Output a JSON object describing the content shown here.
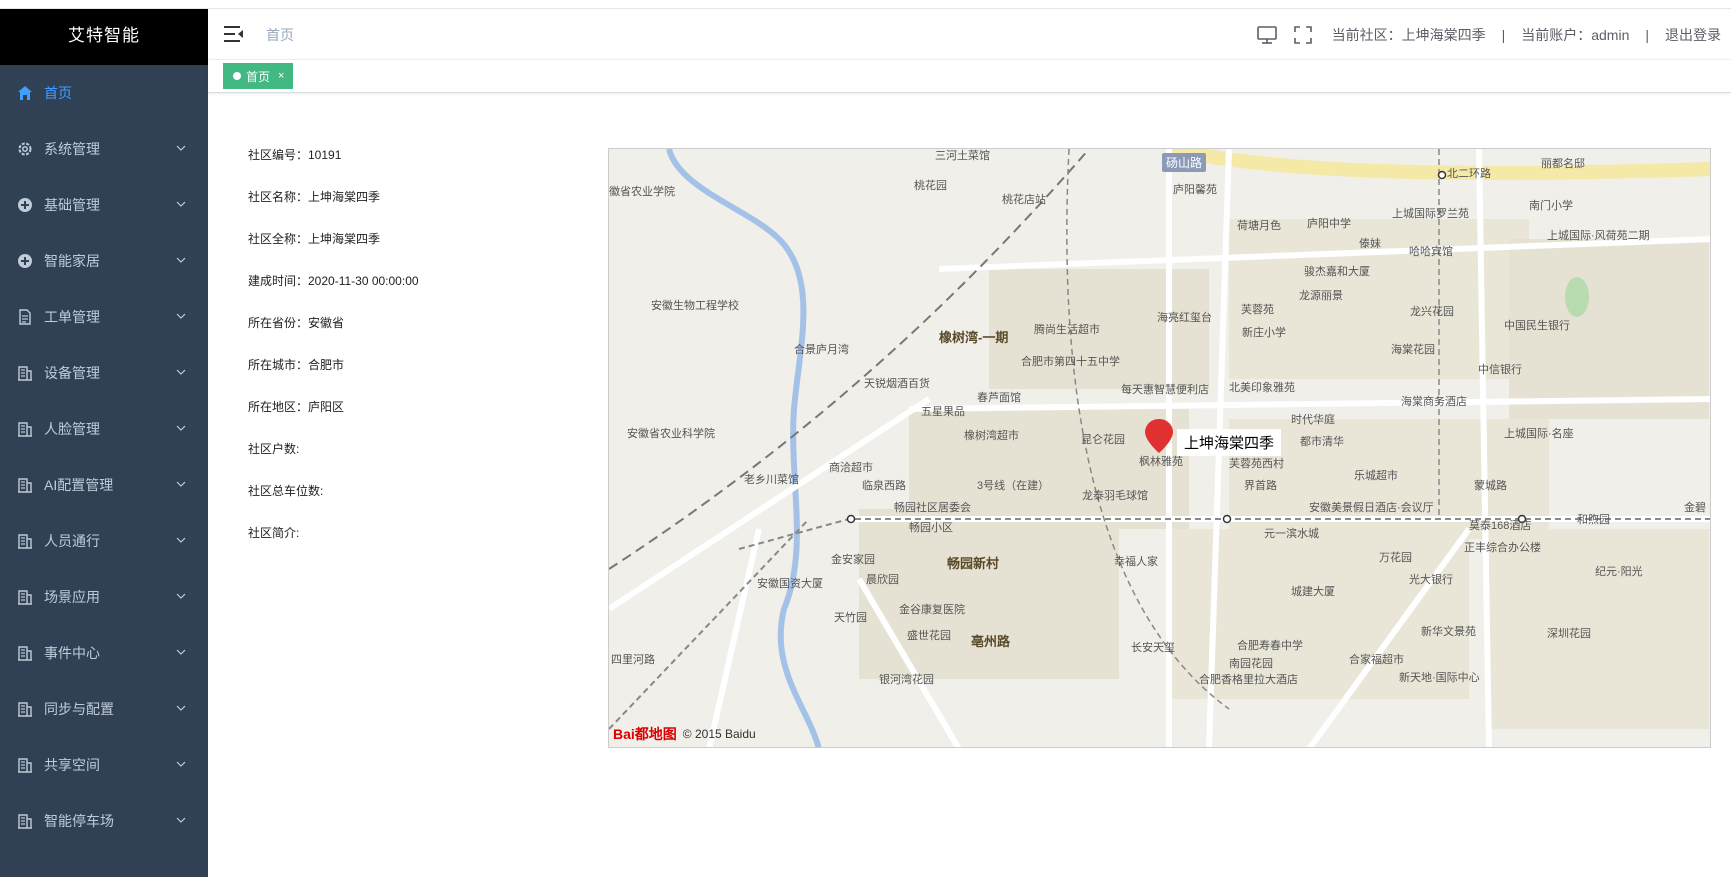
{
  "app": {
    "title": "艾特智能"
  },
  "sidebar": {
    "items": [
      {
        "label": "首页",
        "icon": "home-icon",
        "active": true
      },
      {
        "label": "系统管理",
        "icon": "gear-icon"
      },
      {
        "label": "基础管理",
        "icon": "circle-plus-icon"
      },
      {
        "label": "智能家居",
        "icon": "circle-plus-icon"
      },
      {
        "label": "工单管理",
        "icon": "document-icon"
      },
      {
        "label": "设备管理",
        "icon": "building-icon"
      },
      {
        "label": "人脸管理",
        "icon": "building-icon"
      },
      {
        "label": "AI配置管理",
        "icon": "building-icon"
      },
      {
        "label": "人员通行",
        "icon": "building-icon"
      },
      {
        "label": "场景应用",
        "icon": "building-icon"
      },
      {
        "label": "事件中心",
        "icon": "building-icon"
      },
      {
        "label": "同步与配置",
        "icon": "building-icon"
      },
      {
        "label": "共享空间",
        "icon": "building-icon"
      },
      {
        "label": "智能停车场",
        "icon": "building-icon"
      }
    ]
  },
  "header": {
    "breadcrumb": "首页",
    "current_community": "当前社区：上坤海棠四季",
    "separator": "|",
    "current_account": "当前账户：admin",
    "logout": "退出登录"
  },
  "tags": {
    "active_tag": "首页",
    "close": "×"
  },
  "info": {
    "rows": [
      "社区编号：10191",
      "社区名称：上坤海棠四季",
      "社区全称：上坤海棠四季",
      "建成时间：2020-11-30 00:00:00",
      "所在省份：安徽省",
      "所在城市：合肥市",
      "所在地区：庐阳区",
      "社区户数:",
      "社区总车位数:",
      "社区简介:"
    ]
  },
  "map": {
    "marker_label": "上坤海棠四季",
    "copyright": "© 2015 Baidu",
    "logo_text": "Bai都地图",
    "labels": [
      "三河土菜馆",
      "砀山路",
      "北二环路",
      "丽都名邸",
      "桃花园",
      "桃花店站",
      "庐阳馨苑",
      "徽省农业学院",
      "荷塘月色",
      "庐阳中学",
      "上城国际罗兰苑",
      "南门小学",
      "傣妹",
      "哈哈宾馆",
      "上城国际·风荷苑二期",
      "骏杰嘉和大厦",
      "龙源丽景",
      "龙兴花园",
      "安徽生物工程学校",
      "橡树湾-一期",
      "腾尚生活超市",
      "海亮红玺台",
      "芙蓉苑",
      "中国民生银行",
      "新庄小学",
      "合景庐月湾",
      "合肥市第四十五中学",
      "海棠花园",
      "中信银行",
      "天锐烟酒百货",
      "每天惠智慧便利店",
      "北美印象雅苑",
      "春芦面馆",
      "海棠商务酒店",
      "五星果品",
      "时代华庭",
      "安徽省农业科学院",
      "橡树湾超市",
      "昆仑花园",
      "都市清华",
      "上城国际·名座",
      "商洽超市",
      "枫林雅苑",
      "芙蓉苑西村",
      "乐城超市",
      "老乡川菜馆",
      "临泉西路",
      "3号线（在建）",
      "界首路",
      "蒙城路",
      "龙泰羽毛球馆",
      "畅园社区居委会",
      "安徽美景假日酒店·会议厅",
      "和煦园",
      "金碧",
      "畅园小区",
      "莫泰168酒店",
      "元一滨水城",
      "正丰综合办公楼",
      "金安家园",
      "畅园新村",
      "幸福人家",
      "万花园",
      "纪元·阳光",
      "安徽国资大厦",
      "晨欣园",
      "光大银行",
      "城建大厦",
      "天竹园",
      "金谷康复医院",
      "新华文景苑",
      "深圳花园",
      "盛世花园",
      "亳州路",
      "长安天玺",
      "合肥寿春中学",
      "南园花园",
      "合家福超市",
      "四里河路",
      "银河湾花园",
      "合肥香格里拉大酒店",
      "新天地·国际中心"
    ]
  },
  "colors": {
    "sidebar_bg": "#304156",
    "logo_bg": "#000000",
    "active_menu": "#409eff",
    "tag_green": "#42b983",
    "map_bg": "#f1efe9"
  }
}
